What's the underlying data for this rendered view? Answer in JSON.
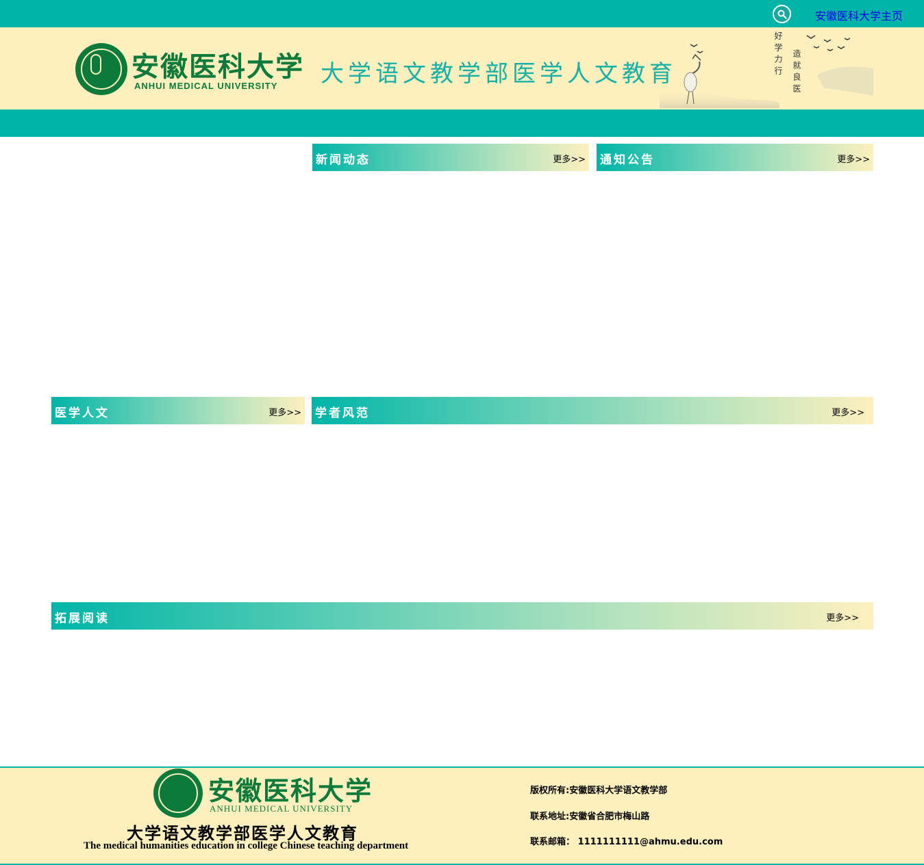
{
  "topbar": {
    "search_icon": "search-icon",
    "home_link": "安徽医科大学主页",
    "link_color": "#0000ee",
    "bg_color": "#00b5a8"
  },
  "banner": {
    "logo_cn": "安徽医科大学",
    "logo_en": "ANHUI MEDICAL UNIVERSITY",
    "site_title": "大学语文教学部医学人文教育",
    "motto_1": "好学力行",
    "motto_2": "造就良医",
    "bg_color": "#fdf0be"
  },
  "panels": {
    "news": {
      "title": "新闻动态",
      "more": "更多>>"
    },
    "notice": {
      "title": "通知公告",
      "more": "更多>>"
    },
    "humanities": {
      "title": "医学人文",
      "more": "更多>>"
    },
    "scholars": {
      "title": "学者风范",
      "more": "更多>>"
    },
    "reading": {
      "title": "拓展阅读",
      "more": "更多>>"
    }
  },
  "footer": {
    "logo_cn": "安徽医科大学",
    "logo_en": "ANHUI MEDICAL UNIVERSITY",
    "title": "大学语文教学部医学人文教育",
    "subtitle": "The medical humanities education in college Chinese teaching department",
    "copyright": "版权所有:安徽医科大学语文教学部",
    "address": "联系地址:安徽省合肥市梅山路",
    "email": "联系邮箱：  1111111111@ahmu.edu.com"
  }
}
